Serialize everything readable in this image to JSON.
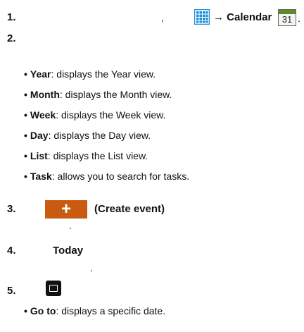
{
  "steps": {
    "s1": {
      "number": "1.",
      "comma": ",",
      "arrow_text": "→ Calendar",
      "calendar_day": "31",
      "period": "."
    },
    "s2": {
      "number": "2."
    },
    "s3": {
      "number": "3.",
      "button_symbol": "+",
      "label": "(Create event)",
      "period": "."
    },
    "s4": {
      "number": "4.",
      "label": "Today",
      "period": "."
    },
    "s5": {
      "number": "5."
    }
  },
  "views": [
    {
      "term": "Year",
      "desc": ": displays the Year view."
    },
    {
      "term": "Month",
      "desc": ": displays the Month view."
    },
    {
      "term": "Week",
      "desc": ": displays the Week view."
    },
    {
      "term": "Day",
      "desc": ": displays the Day view."
    },
    {
      "term": "List",
      "desc": ": displays the List view."
    },
    {
      "term": "Task",
      "desc": ": allows you to search for tasks."
    }
  ],
  "menu_options": [
    {
      "term": "Go to",
      "desc": ": displays a specific date."
    }
  ],
  "bullet": "•",
  "icons": {
    "apps": "apps-grid-icon",
    "calendar": "calendar-icon",
    "menu": "menu-icon"
  },
  "colors": {
    "apps_icon": "#1a8fd6",
    "create_button": "#c95a12",
    "calendar_header": "#5b8a2d"
  }
}
